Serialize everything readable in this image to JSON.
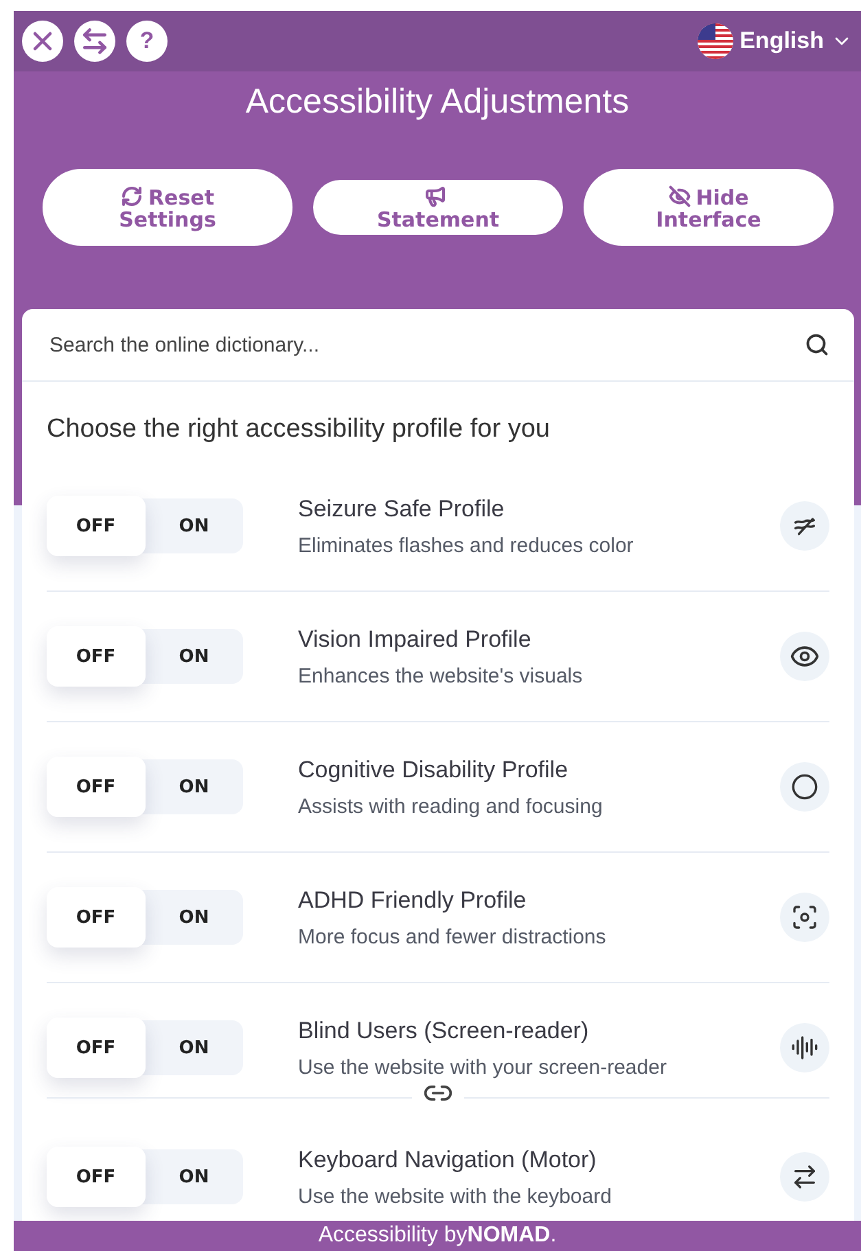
{
  "top_bar": {
    "help_glyph": "?",
    "language": "English"
  },
  "title": "Accessibility Adjustments",
  "actions": [
    {
      "label": "Reset Settings"
    },
    {
      "label": "Statement"
    },
    {
      "label": "Hide Interface"
    }
  ],
  "search": {
    "placeholder": "Search the online dictionary..."
  },
  "profiles_heading": "Choose the right accessibility profile for you",
  "profiles": [
    {
      "off_label": "OFF",
      "on_label": "ON",
      "on": false,
      "name": "Seizure Safe Profile",
      "description": "Eliminates flashes and reduces color",
      "linked": false
    },
    {
      "off_label": "OFF",
      "on_label": "ON",
      "on": false,
      "name": "Vision Impaired Profile",
      "description": "Enhances the website's visuals",
      "linked": false
    },
    {
      "off_label": "OFF",
      "on_label": "ON",
      "on": false,
      "name": "Cognitive Disability Profile",
      "description": "Assists with reading and focusing",
      "linked": false
    },
    {
      "off_label": "OFF",
      "on_label": "ON",
      "on": false,
      "name": "ADHD Friendly Profile",
      "description": "More focus and fewer distractions",
      "linked": false
    },
    {
      "off_label": "OFF",
      "on_label": "ON",
      "on": false,
      "name": "Blind Users (Screen-reader)",
      "description": "Use the website with your screen-reader",
      "linked": true
    },
    {
      "off_label": "OFF",
      "on_label": "ON",
      "on": false,
      "name": "Keyboard Navigation (Motor)",
      "description": "Use the website with the keyboard",
      "linked": false
    }
  ],
  "footer": "Accessibility by**NOMAD**."
}
